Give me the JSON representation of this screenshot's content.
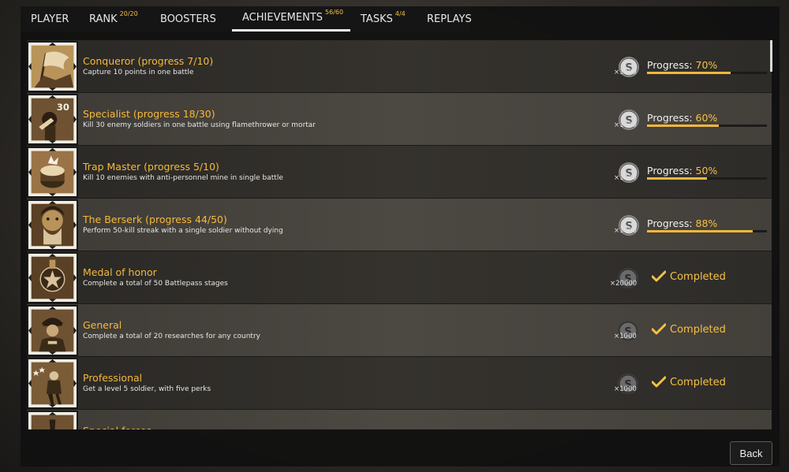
{
  "tabs": [
    {
      "label": "PLAYER",
      "count": ""
    },
    {
      "label": "RANK",
      "count": "20/20"
    },
    {
      "label": "BOOSTERS",
      "count": ""
    },
    {
      "label": "ACHIEVEMENTS",
      "count": "56/60"
    },
    {
      "label": "TASKS",
      "count": "4/4"
    },
    {
      "label": "REPLAYS",
      "count": ""
    }
  ],
  "active_tab": "ACHIEVEMENTS",
  "achievements": [
    {
      "title": "Conqueror (progress 7/10)",
      "desc": "Capture 10 points in one battle",
      "reward": "×1000",
      "status": "progress",
      "progress_label": "Progress: ",
      "progress_pct": "70%",
      "progress": 0.7,
      "icon": "flag-icon"
    },
    {
      "title": "Specialist (progress 18/30)",
      "desc": "Kill 30 enemy soldiers in one battle using flamethrower or mortar",
      "reward": "×1000",
      "status": "progress",
      "progress_label": "Progress: ",
      "progress_pct": "60%",
      "progress": 0.6,
      "icon": "specialist-30-icon",
      "badge_text": "30"
    },
    {
      "title": "Trap Master (progress 5/10)",
      "desc": "Kill 10 enemies with anti-personnel mine in single battle",
      "reward": "×1000",
      "status": "progress",
      "progress_label": "Progress: ",
      "progress_pct": "50%",
      "progress": 0.5,
      "icon": "mine-icon"
    },
    {
      "title": "The Berserk (progress 44/50)",
      "desc": "Perform 50-kill streak with a single soldier without dying",
      "reward": "×1000",
      "status": "progress",
      "progress_label": "Progress: ",
      "progress_pct": "88%",
      "progress": 0.88,
      "icon": "berserk-icon"
    },
    {
      "title": "Medal of honor",
      "desc": "Complete a total of 50 Battlepass stages",
      "reward": "×20000",
      "status": "completed",
      "completed_label": "Completed",
      "icon": "medal-icon"
    },
    {
      "title": "General",
      "desc": "Complete a total of 20 researches for any country",
      "reward": "×1000",
      "status": "completed",
      "completed_label": "Completed",
      "icon": "general-icon"
    },
    {
      "title": "Professional",
      "desc": "Get a level 5 soldier, with five perks",
      "reward": "×1000",
      "status": "completed",
      "completed_label": "Completed",
      "icon": "soldier-icon"
    },
    {
      "title": "Special forces",
      "desc": "",
      "reward": "",
      "status": "partial",
      "icon": "special-forces-icon"
    }
  ],
  "back_label": "Back",
  "colors": {
    "accent": "#f6b93b",
    "progress_fill": "#f3b83a",
    "text": "#e6e6e6"
  }
}
